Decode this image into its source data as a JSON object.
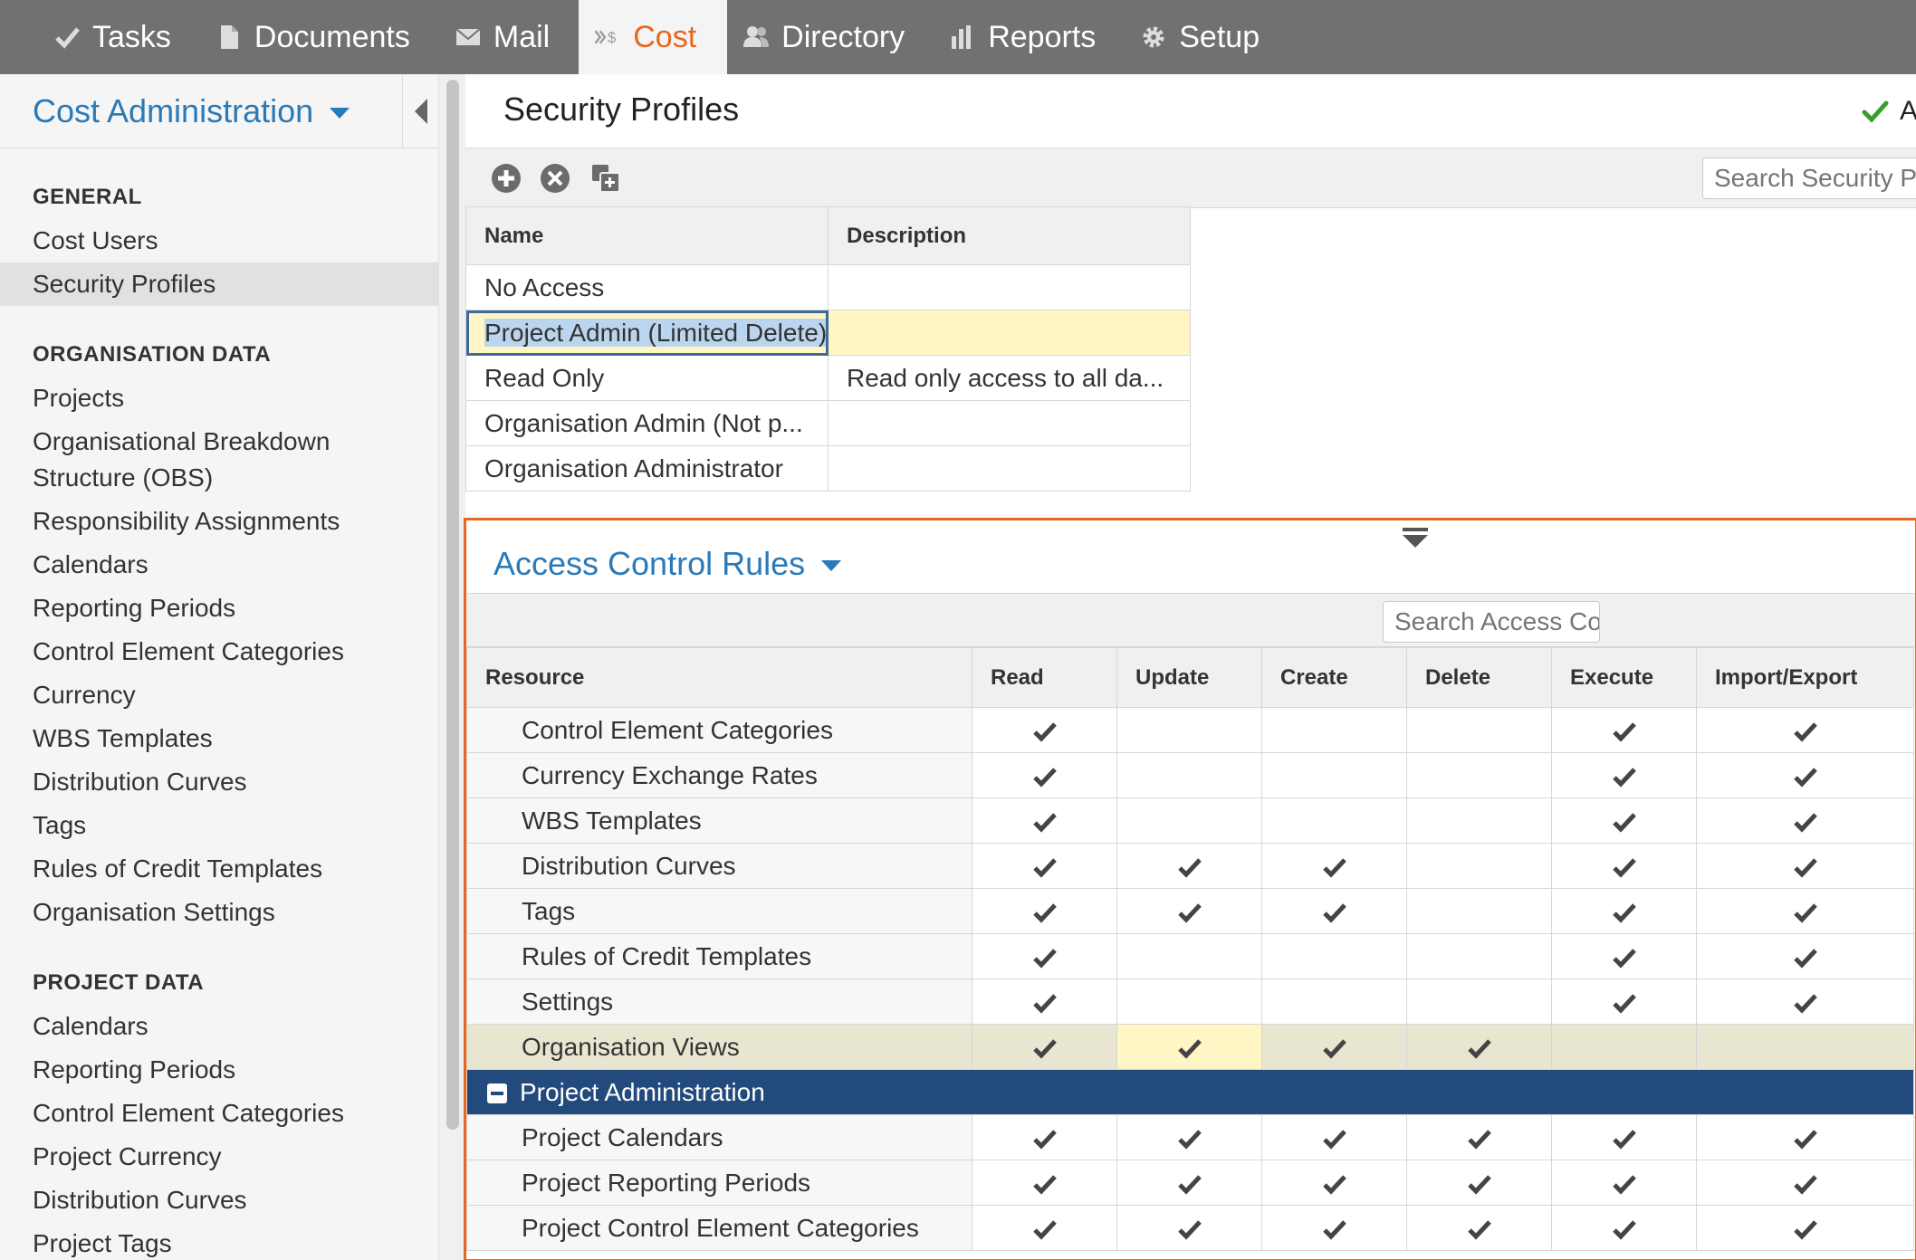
{
  "nav": {
    "tabs": [
      {
        "label": "Tasks",
        "icon": "check-icon"
      },
      {
        "label": "Documents",
        "icon": "document-icon"
      },
      {
        "label": "Mail",
        "icon": "mail-icon"
      },
      {
        "label": "Cost",
        "icon": "cost-icon",
        "active": true
      },
      {
        "label": "Directory",
        "icon": "people-icon"
      },
      {
        "label": "Reports",
        "icon": "bar-chart-icon"
      },
      {
        "label": "Setup",
        "icon": "gear-icon"
      }
    ],
    "accent_color": "#e8661e",
    "bar_color": "#717171"
  },
  "sidebar": {
    "title": "Cost Administration",
    "sections": [
      {
        "heading": "GENERAL",
        "items": [
          "Cost Users",
          "Security Profiles"
        ],
        "selected": "Security Profiles"
      },
      {
        "heading": "ORGANISATION DATA",
        "items": [
          "Projects",
          "Organisational Breakdown Structure (OBS)",
          "Responsibility Assignments",
          "Calendars",
          "Reporting Periods",
          "Control Element Categories",
          "Currency",
          "WBS Templates",
          "Distribution Curves",
          "Tags",
          "Rules of Credit Templates",
          "Organisation Settings"
        ]
      },
      {
        "heading": "PROJECT DATA",
        "items": [
          "Calendars",
          "Reporting Periods",
          "Control Element Categories",
          "Project Currency",
          "Distribution Curves",
          "Project Tags"
        ]
      }
    ]
  },
  "main": {
    "title": "Security Profiles",
    "status_text": "A",
    "search_placeholder": "Search Security Profiles",
    "profiles": {
      "columns": [
        "Name",
        "Description"
      ],
      "rows": [
        {
          "name": "No Access",
          "description": ""
        },
        {
          "name": "Project Admin (Limited Delete)",
          "description": "",
          "editing": true
        },
        {
          "name": "Read Only",
          "description": "Read only access to all da..."
        },
        {
          "name": "Organisation Admin (Not p...",
          "description": ""
        },
        {
          "name": "Organisation Administrator",
          "description": ""
        }
      ]
    }
  },
  "acr": {
    "title": "Access Control Rules",
    "search_placeholder": "Search Access Control Rules",
    "columns": [
      "Resource",
      "Read",
      "Update",
      "Create",
      "Delete",
      "Execute",
      "Import/Export"
    ],
    "rows": [
      {
        "resource": "Control Element Categories",
        "perms": [
          true,
          false,
          false,
          false,
          true,
          true
        ]
      },
      {
        "resource": "Currency Exchange Rates",
        "perms": [
          true,
          false,
          false,
          false,
          true,
          true
        ]
      },
      {
        "resource": "WBS Templates",
        "perms": [
          true,
          false,
          false,
          false,
          true,
          true
        ]
      },
      {
        "resource": "Distribution Curves",
        "perms": [
          true,
          true,
          true,
          false,
          true,
          true
        ]
      },
      {
        "resource": "Tags",
        "perms": [
          true,
          true,
          true,
          false,
          true,
          true
        ]
      },
      {
        "resource": "Rules of Credit Templates",
        "perms": [
          true,
          false,
          false,
          false,
          true,
          true
        ]
      },
      {
        "resource": "Settings",
        "perms": [
          true,
          false,
          false,
          false,
          true,
          true
        ]
      },
      {
        "resource": "Organisation Views",
        "perms": [
          true,
          true,
          true,
          true,
          false,
          false
        ],
        "highlight": true
      },
      {
        "group": "Project Administration"
      },
      {
        "resource": "Project Calendars",
        "perms": [
          true,
          true,
          true,
          true,
          true,
          true
        ]
      },
      {
        "resource": "Project Reporting Periods",
        "perms": [
          true,
          true,
          true,
          true,
          true,
          true
        ]
      },
      {
        "resource": "Project Control Element Categories",
        "perms": [
          true,
          true,
          true,
          true,
          true,
          true
        ]
      }
    ],
    "group_color": "#234a7c",
    "border_color": "#e8661e"
  }
}
